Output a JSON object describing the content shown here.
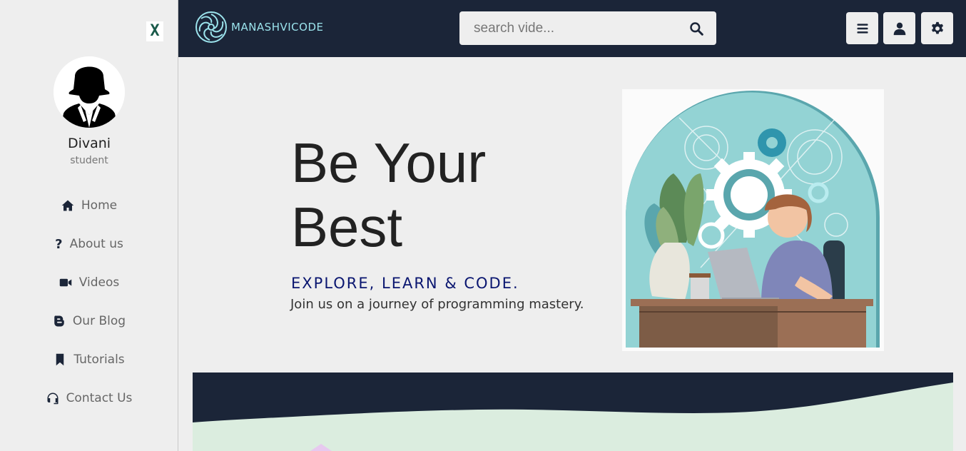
{
  "sidebar": {
    "close_label": "X",
    "profile": {
      "name": "Divani",
      "role": "student"
    },
    "items": [
      {
        "label": "Home",
        "icon": "home-icon"
      },
      {
        "label": "About us",
        "icon": "question-icon"
      },
      {
        "label": "Videos",
        "icon": "video-icon"
      },
      {
        "label": "Our Blog",
        "icon": "blogger-icon"
      },
      {
        "label": "Tutorials",
        "icon": "bookmark-icon"
      },
      {
        "label": "Contact Us",
        "icon": "headset-icon"
      }
    ]
  },
  "header": {
    "logo_text": "MANASHVICODE",
    "search": {
      "placeholder": "search vide..."
    },
    "buttons": [
      "menu-icon",
      "user-icon",
      "gear-icon"
    ]
  },
  "hero": {
    "title_line1": "Be Your",
    "title_line2": "Best",
    "subtitle": "EXPLORE, LEARN & CODE.",
    "description": "Join us on a journey of programming mastery."
  },
  "colors": {
    "navy": "#1b2538",
    "background": "#eeeeee",
    "accent_teal": "#9be3ec",
    "subtitle_blue": "#0a1670",
    "wave_mint": "#dbeddf"
  }
}
